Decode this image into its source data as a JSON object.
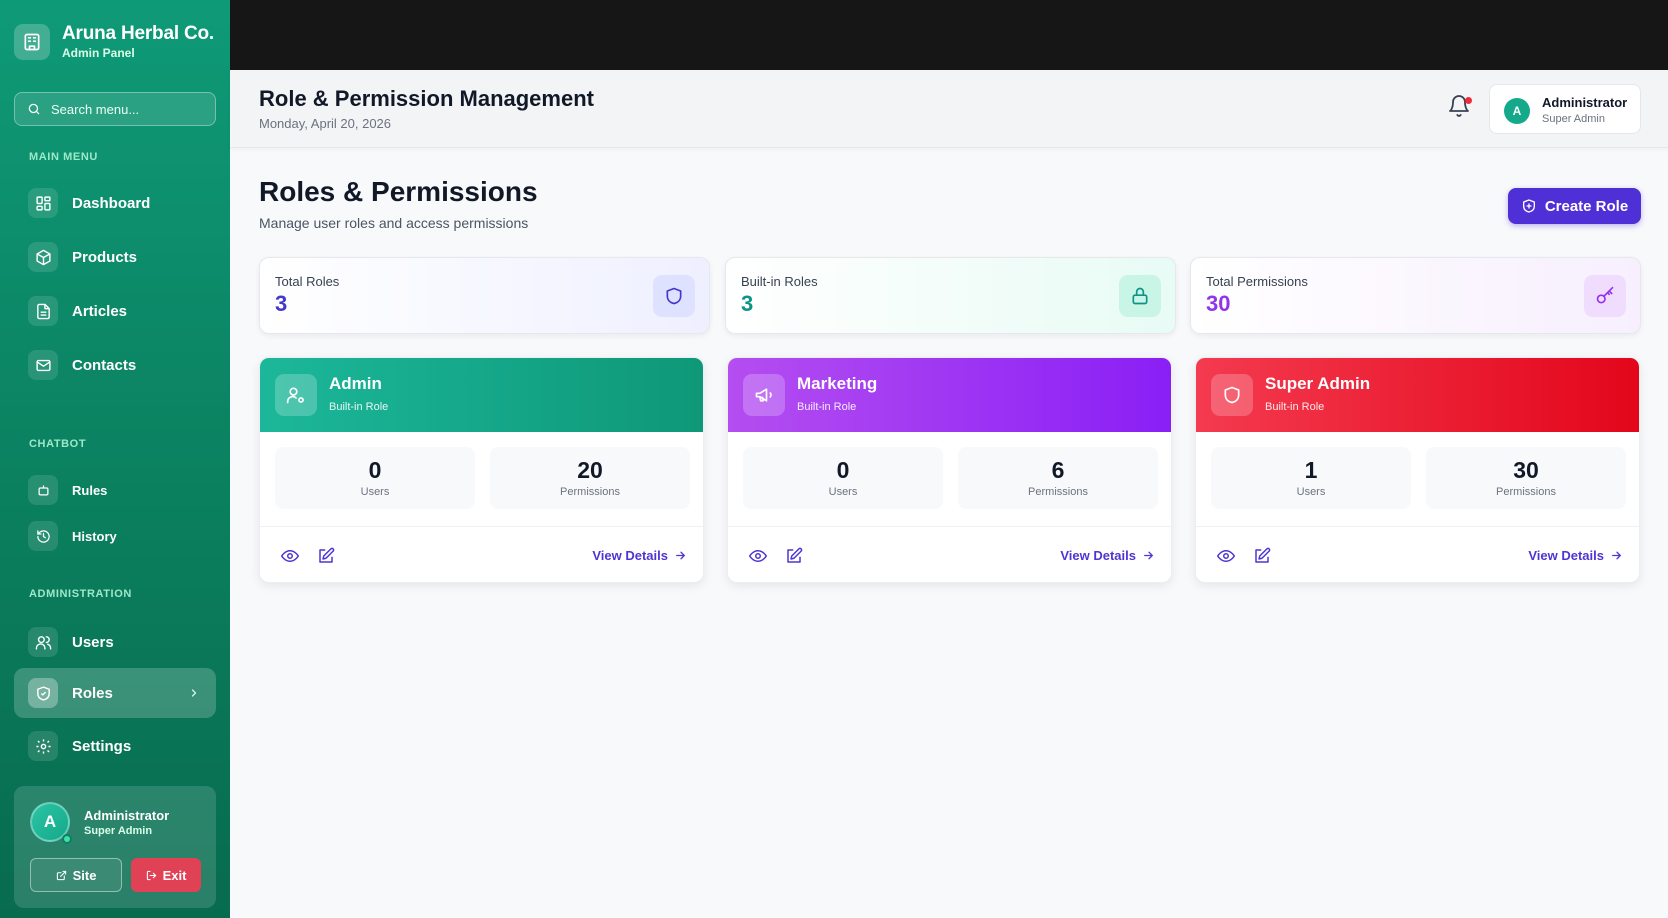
{
  "brand": {
    "title": "Aruna Herbal Co.",
    "subtitle": "Admin Panel",
    "icon": "building-icon"
  },
  "search": {
    "placeholder": "Search menu..."
  },
  "sections": {
    "main": "MAIN MENU",
    "chatbot": "CHATBOT",
    "admin": "ADMINISTRATION"
  },
  "nav": {
    "dashboard": "Dashboard",
    "products": "Products",
    "articles": "Articles",
    "contacts": "Contacts",
    "rules": "Rules",
    "history": "History",
    "users": "Users",
    "roles": "Roles",
    "settings": "Settings"
  },
  "sidebar_user": {
    "initial": "A",
    "name": "Administrator",
    "role": "Super Admin",
    "site_label": "Site",
    "exit_label": "Exit"
  },
  "header": {
    "title": "Role & Permission Management",
    "date": "Monday, April 20, 2026"
  },
  "header_user": {
    "initial": "A",
    "name": "Administrator",
    "role": "Super Admin"
  },
  "page": {
    "title": "Roles & Permissions",
    "subtitle": "Manage user roles and access permissions",
    "create_label": "Create Role"
  },
  "stats": [
    {
      "label": "Total Roles",
      "value": "3",
      "color": "#4338ca",
      "icon": "shield-icon"
    },
    {
      "label": "Built-in Roles",
      "value": "3",
      "color": "#0d9488",
      "icon": "lock-icon"
    },
    {
      "label": "Total Permissions",
      "value": "30",
      "color": "#9333ea",
      "icon": "key-icon"
    }
  ],
  "roles": [
    {
      "name": "Admin",
      "tag": "Built-in Role",
      "users": "0",
      "users_label": "Users",
      "permissions": "20",
      "permissions_label": "Permissions",
      "link": "View Details",
      "color_from": "#1cb79a",
      "color_to": "#0e9878",
      "icon": "user-gear-icon"
    },
    {
      "name": "Marketing",
      "tag": "Built-in Role",
      "users": "0",
      "users_label": "Users",
      "permissions": "6",
      "permissions_label": "Permissions",
      "link": "View Details",
      "color_from": "#b44ef0",
      "color_to": "#8a1ff5",
      "icon": "megaphone-icon"
    },
    {
      "name": "Super Admin",
      "tag": "Built-in Role",
      "users": "1",
      "users_label": "Users",
      "permissions": "30",
      "permissions_label": "Permissions",
      "link": "View Details",
      "color_from": "#f43a4f",
      "color_to": "#e3061b",
      "icon": "shield-icon"
    }
  ]
}
